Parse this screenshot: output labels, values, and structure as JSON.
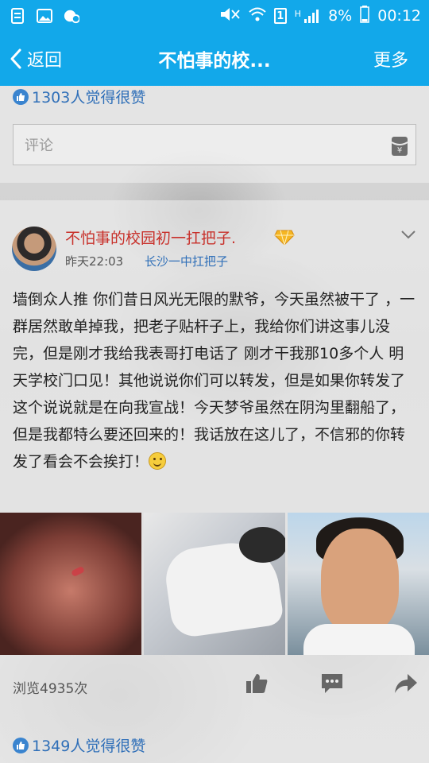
{
  "status_bar": {
    "battery": "8%",
    "time": "00:12",
    "sim_label": "1",
    "network_label": "H"
  },
  "nav": {
    "back_label": "返回",
    "title": "不怕事的校...",
    "more_label": "更多",
    "bar_color": "#12a8ea"
  },
  "prev_post": {
    "likes": "1303人觉得很赞",
    "comment_placeholder": "评论"
  },
  "post": {
    "author": "不怕事的校园初一扛把子.",
    "time": "昨天22:03",
    "location": "长沙一中扛把子",
    "text": "墙倒众人推 你们昔日风光无限的默爷，今天虽然被干了 ，一群居然敢单掉我，把老子贴杆子上，我给你们讲这事儿没完，但是刚才我给我表哥打电话了 刚才干我那10多个人 明天学校门口见！其他说说你们可以转发，但是如果你转发了这个说说就是在向我宣战！今天梦爷虽然在阴沟里翻船了，但是我都特么要还回来的！我话放在这儿了，不信邪的你转发了看会不会挨打！",
    "views": "浏览4935次",
    "likes": "1349人觉得很赞",
    "author_color": "#c8312b",
    "link_color": "#2f6fb8"
  },
  "icons": {
    "status_left": [
      "notes-icon",
      "image-icon",
      "qq-notify-icon"
    ],
    "status_right": [
      "mute-icon",
      "wifi-icon",
      "sim-icon",
      "signal-icon",
      "battery-icon"
    ],
    "actions": [
      "thumbs-up-icon",
      "comment-icon",
      "share-icon"
    ]
  }
}
